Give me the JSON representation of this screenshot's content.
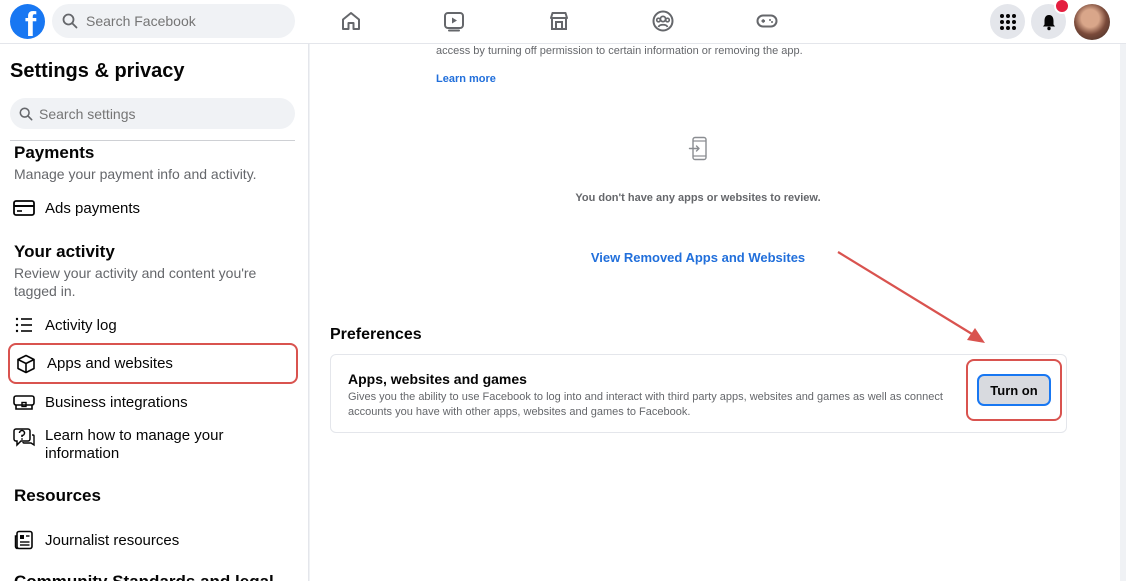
{
  "topbar": {
    "logo_letter": "f",
    "search_placeholder": "Search Facebook",
    "nav_icons": [
      "home-icon",
      "watch-icon",
      "marketplace-icon",
      "groups-icon",
      "gaming-icon"
    ],
    "menu_icon": "grid-menu-icon",
    "notifications_icon": "bell-icon",
    "accent_color": "#1877f2"
  },
  "sidebar": {
    "title": "Settings & privacy",
    "search_placeholder": "Search settings",
    "payments": {
      "title": "Payments",
      "desc": "Manage your payment info and activity.",
      "items": [
        {
          "label": "Ads payments",
          "icon": "card-icon"
        }
      ]
    },
    "activity": {
      "title": "Your activity",
      "desc": "Review your activity and content you're tagged in.",
      "items": [
        {
          "label": "Activity log",
          "icon": "list-icon"
        },
        {
          "label": "Apps and websites",
          "icon": "cube-icon"
        },
        {
          "label": "Business integrations",
          "icon": "business-icon"
        },
        {
          "label": "Learn how to manage your information",
          "icon": "help-icon"
        }
      ]
    },
    "resources": {
      "title": "Resources",
      "items": [
        {
          "label": "Journalist resources",
          "icon": "newspaper-icon"
        }
      ]
    },
    "cut_off_title": "Community Standards and legal"
  },
  "main": {
    "top_desc": "access by turning off permission to certain information or removing the app.",
    "learn_more": "Learn more",
    "empty_text": "You don't have any apps or websites to review.",
    "view_removed": "View Removed Apps and Websites",
    "preferences": {
      "title": "Preferences",
      "card_title": "Apps, websites and games",
      "card_desc": "Gives you the ability to use Facebook to log into and interact with third party apps, websites and games as well as connect accounts you have with other apps, websites and games to Facebook.",
      "button_label": "Turn on"
    }
  },
  "annotation_color": "#d9534f"
}
